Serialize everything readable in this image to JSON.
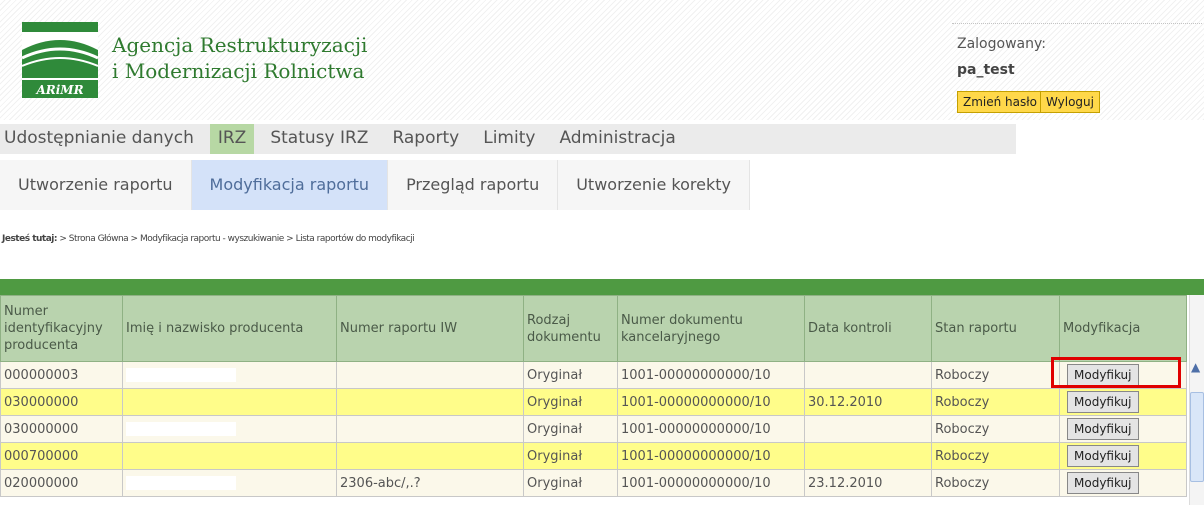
{
  "org": {
    "line1": "Agencja Restrukturyzacji",
    "line2": "i Modernizacji Rolnictwa",
    "logo_text": "ARiMR"
  },
  "session": {
    "label": "Zalogowany:",
    "user": "pa_test",
    "change_password": "Zmień hasło",
    "logout": "Wyloguj"
  },
  "topmenu": [
    "Udostępnianie danych",
    "IRZ",
    "Statusy IRZ",
    "Raporty",
    "Limity",
    "Administracja"
  ],
  "submenu": [
    "Utworzenie raportu",
    "Modyfikacja raportu",
    "Przegląd raportu",
    "Utworzenie korekty"
  ],
  "breadcrumb": {
    "label": "Jesteś tutaj:",
    "path": " > Strona Główna > Modyfikacja raportu - wyszukiwanie > Lista raportów do modyfikacji"
  },
  "table": {
    "headers": [
      "Numer identyfikacyjny producenta",
      "Imię i nazwisko producenta",
      "Numer raportu IW",
      "Rodzaj dokumentu",
      "Numer dokumentu kancelaryjnego",
      "Data kontroli",
      "Stan raportu",
      "Modyfikacja"
    ],
    "rows": [
      {
        "id": "000000003",
        "nr_iw": "",
        "rodzaj": "Oryginał",
        "nr_dok": "1001-00000000000/10",
        "data": "",
        "stan": "Roboczy",
        "akcja": "Modyfikuj"
      },
      {
        "id": "030000000",
        "nr_iw": "",
        "rodzaj": "Oryginał",
        "nr_dok": "1001-00000000000/10",
        "data": "30.12.2010",
        "stan": "Roboczy",
        "akcja": "Modyfikuj"
      },
      {
        "id": "030000000",
        "nr_iw": "",
        "rodzaj": "Oryginał",
        "nr_dok": "1001-00000000000/10",
        "data": "",
        "stan": "Roboczy",
        "akcja": "Modyfikuj"
      },
      {
        "id": "000700000",
        "nr_iw": "",
        "rodzaj": "Oryginał",
        "nr_dok": "1001-00000000000/10",
        "data": "",
        "stan": "Roboczy",
        "akcja": "Modyfikuj"
      },
      {
        "id": "020000000",
        "nr_iw": "2306-abc/,.?",
        "rodzaj": "Oryginał",
        "nr_dok": "1001-00000000000/10",
        "data": "23.12.2010",
        "stan": "Roboczy",
        "akcja": "Modyfikuj"
      }
    ]
  },
  "colors": {
    "accent_green": "#4f9a42",
    "header_green": "#b9d3ae",
    "highlight_yellow": "#fffd8a",
    "active_tab_blue": "#d4e2f9",
    "button_yellow": "#ffd84a"
  }
}
